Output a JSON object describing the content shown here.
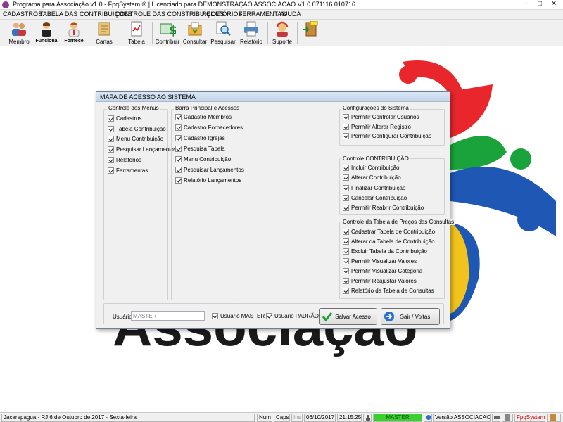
{
  "window": {
    "title": "Programa para Associação v1.0 - FpqSystem ® | Licenciado para  DEMONSTRAÇÃO ASSOCIACAO V1.0 071116 010716",
    "minimize": "–",
    "maximize": "□",
    "close": "✕"
  },
  "menu": [
    {
      "label": "CADASTROS"
    },
    {
      "label": "TABELA DAS CONTRIBUIÇÕES"
    },
    {
      "label": "CONTROLE DAS CONSTRIBUIÇÕES"
    },
    {
      "label": "RELATÓRIOS"
    },
    {
      "label": "FERRAMENTAS"
    },
    {
      "label": "AJUDA"
    }
  ],
  "toolbar": {
    "membro": "Membro",
    "funciona": "Funciona",
    "fornece": "Fornece",
    "cartas": "Cartas",
    "tabela": "Tabela",
    "contribuir": "Contribuir",
    "consultar": "Consultar",
    "pesquisar": "Pesquisar",
    "relatorio": "Relatório",
    "suporte": "Suporte",
    "exit_icon": "exit-door-icon"
  },
  "background_logo": {
    "text": "Associação",
    "colors": [
      "#e8262c",
      "#1aa33a",
      "#1f57b5",
      "#f2c41b"
    ]
  },
  "dialog": {
    "title": "MAPA DE ACESSO AO SISTEMA",
    "menus": {
      "label": "Controle dos Menus",
      "items": [
        "Cadastros",
        "Tabela Contribuição",
        "Menu Contribuição",
        "Pesquisar Lançamentos",
        "Relatórios",
        "Ferramentas"
      ]
    },
    "barra": {
      "label": "Barra Principal e Acessos",
      "items": [
        "Cadastro Membros",
        "Cadastro Fornecedores",
        "Cadastro Igrejas",
        "Pesquisa Tabela",
        "Menu Contribuição",
        "Pesquisar Lançamentos",
        "Relatório Lançamentos"
      ]
    },
    "config": {
      "label": "Configurações do Sistema",
      "items": [
        "Permitir Controlar Usuários",
        "Permitir Alterar Registro",
        "Permitir Configurar Contribuição"
      ]
    },
    "contrib": {
      "label": "Controle CONTRIBUIÇÃO",
      "items": [
        "Incluir Contribuição",
        "Alterar Contribuição",
        "Finalizar Contribuição",
        "Cancelar Contribuição",
        "Permitir Reabrir Contribuição"
      ]
    },
    "precos": {
      "label": "Controle da Tabela de Preços das Consultas",
      "items": [
        "Cadastrar Tabela de Contribuição",
        "Alterar da Tabela de Contribuição",
        "Excluir Tabela da Contribuição",
        "Permitir Visualizar Valores",
        "Permitir Visualizar Categoria",
        "Permitir Reajustar Valores",
        "Relatório da Tabela de Consultas"
      ]
    },
    "usuario_label": "Usuário:",
    "usuario_value": "MASTER",
    "usuario_master": "Usuário MASTER",
    "usuario_padrao": "Usuário PADRÃO",
    "salvar": "Salvar Acesso",
    "sair": "Sair / Voltas"
  },
  "status": {
    "location": "Jacarepagua - RJ  6 de Outubro de 2017 - Sexta-feira",
    "num": "Num",
    "caps": "Caps",
    "ins": "Ins",
    "date": "06/10/2017",
    "time": "21:15:25",
    "user": "MASTER",
    "version": "Versão ASSOCIACAO 1.0",
    "brand": "FpqSystem"
  }
}
